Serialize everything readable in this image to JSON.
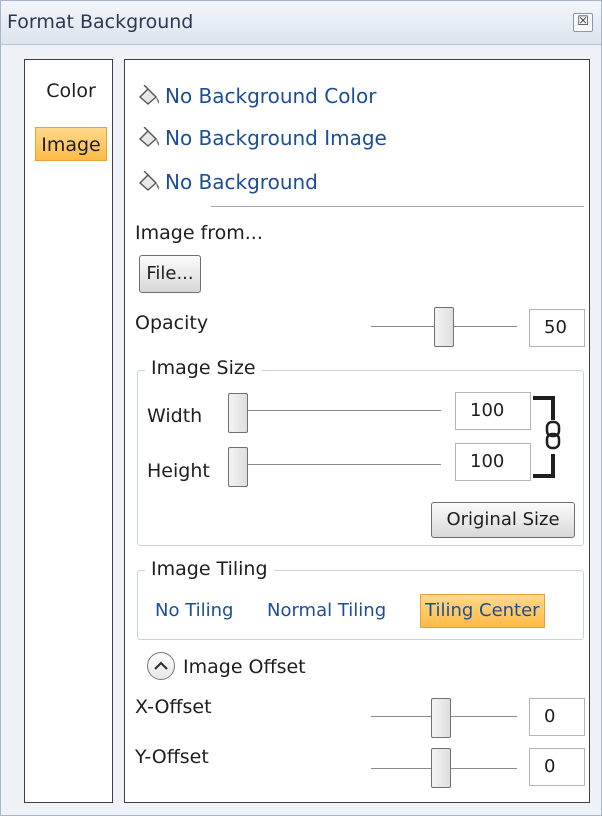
{
  "window": {
    "title": "Format Background",
    "close_icon": "close-icon"
  },
  "tabs": [
    {
      "label": "Color",
      "selected": false
    },
    {
      "label": "Image",
      "selected": true
    }
  ],
  "background_options": [
    {
      "label": "No Background Color",
      "icon": "paint-bucket-icon"
    },
    {
      "label": "No Background Image",
      "icon": "paint-bucket-icon"
    },
    {
      "label": "No Background",
      "icon": "paint-bucket-icon"
    }
  ],
  "image_from": {
    "label": "Image from...",
    "file_button": "File..."
  },
  "opacity": {
    "label": "Opacity",
    "value": "50",
    "slider_fraction": 0.5
  },
  "image_size": {
    "legend": "Image Size",
    "width_label": "Width",
    "width_value": "100",
    "height_label": "Height",
    "height_value": "100",
    "original_size_button": "Original Size",
    "lock_icon": "chain-link-icon"
  },
  "image_tiling": {
    "legend": "Image Tiling",
    "options": [
      "No Tiling",
      "Normal Tiling",
      "Tiling Center"
    ],
    "selected": "Tiling Center"
  },
  "image_offset": {
    "label": "Image Offset",
    "expander_icon": "chevron-up-icon",
    "x_label": "X-Offset",
    "x_value": "0",
    "y_label": "Y-Offset",
    "y_value": "0"
  },
  "colors": {
    "accent": "#ffbb47",
    "link": "#1b4e96"
  }
}
